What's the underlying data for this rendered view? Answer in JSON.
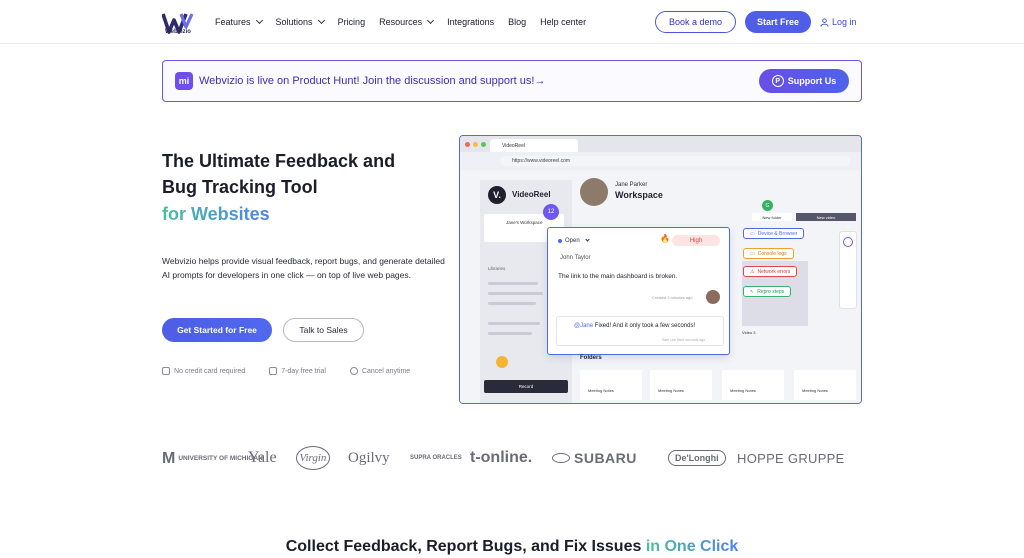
{
  "brand": {
    "name": "Webvizio"
  },
  "nav": {
    "items": [
      {
        "label": "Features",
        "dropdown": true
      },
      {
        "label": "Solutions",
        "dropdown": true
      },
      {
        "label": "Pricing",
        "dropdown": false
      },
      {
        "label": "Resources",
        "dropdown": true
      },
      {
        "label": "Integrations",
        "dropdown": false
      },
      {
        "label": "Blog",
        "dropdown": false
      },
      {
        "label": "Help center",
        "dropdown": false
      }
    ],
    "book_demo": "Book a demo",
    "start_free": "Start Free",
    "login": "Log in"
  },
  "banner": {
    "icon": "mi",
    "text": "Webvizio is live on Product Hunt! Join the discussion and support us!→",
    "button": "Support Us",
    "button_icon": "P"
  },
  "hero": {
    "title": "The Ultimate Feedback and Bug Tracking Tool",
    "accent": "for Websites",
    "description": "Webvizio helps provide visual feedback, report bugs, and generate detailed AI prompts for developers in one click — on top of live web pages.",
    "cta_primary": "Get Started for Free",
    "cta_secondary": "Talk to Sales",
    "perks": [
      "No credit card required",
      "7-day free trial",
      "Cancel anytime"
    ]
  },
  "mockup": {
    "tab_title": "VideoReel",
    "url": "https://www.videoreel.com",
    "sidebar_brand_initial": "V.",
    "sidebar_brand": "VideoReel",
    "workspace_card": "Jane's Workspace",
    "badge_count": "12",
    "libraries_label": "Libraries",
    "record_label": "Record",
    "user_name": "Jane Parker",
    "workspace_title": "Workspace",
    "green_badge": "G",
    "new_folder": "New folder",
    "new_video": "New video",
    "popup": {
      "status": "Open",
      "priority": "High",
      "priority_icon": "🔥",
      "assignee": "John Taylor",
      "message": "The link to the main dashboard is broken.",
      "meta": "Created 3 minutes ago",
      "reply_mention": "@Jane",
      "reply_text": " Fixed! And it only took a few seconds!",
      "reply_meta": "Sam Lee fixed seconds ago"
    },
    "pills": [
      {
        "label": "Device & Browser",
        "color": "#4e6be8"
      },
      {
        "label": "Console logs",
        "color": "#f0a030"
      },
      {
        "label": "Network errors",
        "color": "#e04848"
      },
      {
        "label": "Repro steps",
        "color": "#3ab06a"
      }
    ],
    "thumb_label": "Video 3",
    "folders_label": "Folders",
    "folder_names": [
      "Meeting Notes",
      "Meeting Notes",
      "Meeting Notes",
      "Meeting Notes"
    ]
  },
  "logos": [
    "UNIVERSITY OF MICHIGAN",
    "Yale",
    "Virgin",
    "Ogilvy",
    "SUPRA ORACLES",
    "t-online.",
    "SUBARU",
    "De'Longhi",
    "HOPPE GRUPPE"
  ],
  "bottom": {
    "title": "Collect Feedback, Report Bugs, and Fix Issues ",
    "accent": "in One Click"
  },
  "colors": {
    "primary": "#4f5de8",
    "accent_gradient_start": "#4bbf9a",
    "accent_gradient_end": "#4d7ff0"
  }
}
